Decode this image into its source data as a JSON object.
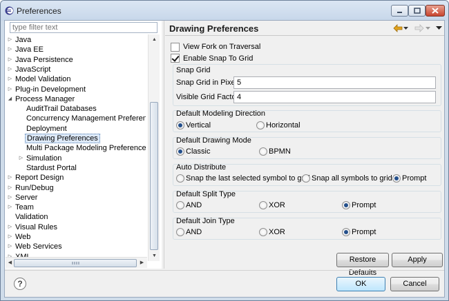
{
  "window": {
    "title": "Preferences"
  },
  "filter": {
    "placeholder": "type filter text"
  },
  "tree": {
    "items": [
      {
        "label": "Java",
        "expandable": true
      },
      {
        "label": "Java EE",
        "expandable": true
      },
      {
        "label": "Java Persistence",
        "expandable": true
      },
      {
        "label": "JavaScript",
        "expandable": true
      },
      {
        "label": "Model Validation",
        "expandable": true
      },
      {
        "label": "Plug-in Development",
        "expandable": true
      },
      {
        "label": "Process Manager",
        "expanded": true
      },
      {
        "label": "AuditTrail Databases"
      },
      {
        "label": "Concurrency Management Preferences"
      },
      {
        "label": "Deployment"
      },
      {
        "label": "Drawing Preferences",
        "selected": true
      },
      {
        "label": "Multi Package Modeling Preferences"
      },
      {
        "label": "Simulation",
        "expandable": true
      },
      {
        "label": "Stardust Portal"
      },
      {
        "label": "Report Design",
        "expandable": true
      },
      {
        "label": "Run/Debug",
        "expandable": true
      },
      {
        "label": "Server",
        "expandable": true
      },
      {
        "label": "Team",
        "expandable": true
      },
      {
        "label": "Validation"
      },
      {
        "label": "Visual Rules",
        "expandable": true
      },
      {
        "label": "Web",
        "expandable": true
      },
      {
        "label": "Web Services",
        "expandable": true
      },
      {
        "label": "XML",
        "expandable": true
      }
    ]
  },
  "page": {
    "title": "Drawing Preferences",
    "view_fork": {
      "label": "View Fork on Traversal",
      "checked": false
    },
    "enable_snap": {
      "label": "Enable Snap To Grid",
      "checked": true
    },
    "snap_grid": {
      "title": "Snap Grid",
      "pixel_label": "Snap Grid in Pixel",
      "pixel_value": "5",
      "factor_label": "Visible Grid Factor",
      "factor_value": "4"
    },
    "modeling_direction": {
      "title": "Default Modeling Direction",
      "options": [
        "Vertical",
        "Horizontal"
      ],
      "selected": "Vertical"
    },
    "drawing_mode": {
      "title": "Default Drawing Mode",
      "options": [
        "Classic",
        "BPMN"
      ],
      "selected": "Classic"
    },
    "auto_distribute": {
      "title": "Auto Distribute",
      "options": [
        "Snap the last selected symbol to grid",
        "Snap all symbols to grid",
        "Prompt"
      ],
      "selected": "Prompt"
    },
    "split_type": {
      "title": "Default Split Type",
      "options": [
        "AND",
        "XOR",
        "Prompt"
      ],
      "selected": "Prompt"
    },
    "join_type": {
      "title": "Default Join Type",
      "options": [
        "AND",
        "XOR",
        "Prompt"
      ],
      "selected": "Prompt"
    }
  },
  "buttons": {
    "restore_defaults": "Restore Defaults",
    "apply": "Apply",
    "ok": "OK",
    "cancel": "Cancel"
  },
  "icons": {
    "back": "back-arrow-icon",
    "forward": "forward-arrow-icon",
    "menu": "view-menu-icon",
    "help": "help-icon"
  },
  "colors": {
    "accent": "#234f8b",
    "back_arrow": "#e2a31e",
    "selection": "#dde9f8"
  }
}
